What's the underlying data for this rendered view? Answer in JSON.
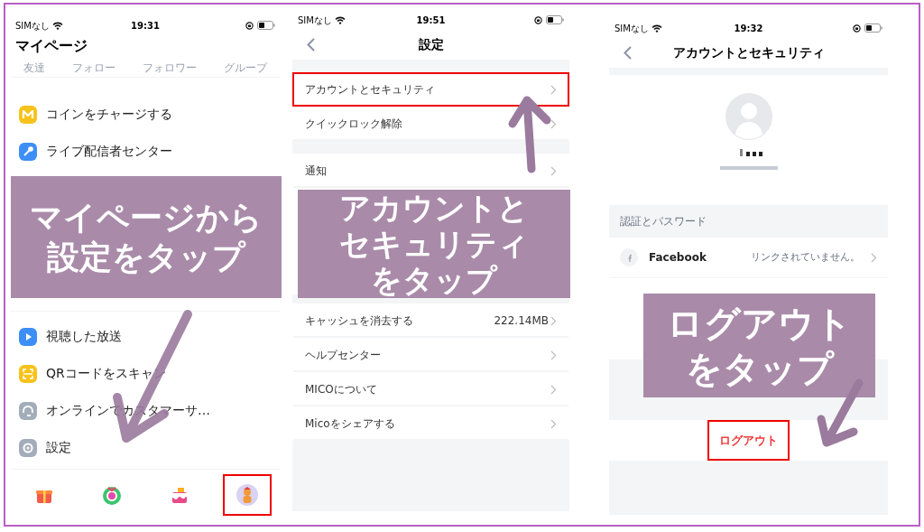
{
  "my_page": {
    "status": {
      "carrier": "SIMなし",
      "time": "19:31"
    },
    "title": "マイページ",
    "tabs": [
      "友達",
      "フォロー",
      "フォロワー",
      "グループ"
    ],
    "sections": [
      {
        "kind": "partly_covered",
        "items": [
          {
            "label": "コインをチャージする"
          },
          {
            "label": "ライブ配信者センター"
          }
        ]
      },
      {
        "kind": "plain",
        "items": [
          {
            "label": "視聴した放送"
          },
          {
            "label": "QRコードをスキャン"
          },
          {
            "label": "オンラインでカスタマーサ…"
          },
          {
            "label": "設定"
          }
        ]
      }
    ],
    "bottom_nav": [
      {
        "highlighted": false
      },
      {
        "highlighted": false
      },
      {
        "highlighted": false
      },
      {
        "highlighted": true
      }
    ]
  },
  "settings": {
    "status": {
      "carrier": "SIMなし",
      "time": "19:51"
    },
    "title": "設定",
    "groups": [
      {
        "kind": "plain",
        "rows": [
          {
            "label": "アカウントとセキュリティ",
            "highlighted": true
          },
          {
            "label": "クイックロック解除",
            "highlighted": false
          }
        ]
      },
      {
        "kind": "partly_covered",
        "rows": [
          {
            "label": "通知",
            "highlighted": false
          }
        ]
      },
      {
        "kind": "plain",
        "rows": [
          {
            "label": "キャッシュを消去する",
            "value": "222.14MB",
            "highlighted": false
          },
          {
            "label": "ヘルプセンター",
            "highlighted": false
          },
          {
            "label": "MICOについて",
            "highlighted": false
          },
          {
            "label": "Micoをシェアする",
            "highlighted": false
          }
        ]
      }
    ]
  },
  "account": {
    "status": {
      "carrier": "SIMなし",
      "time": "19:32"
    },
    "title": "アカウントとセキュリティ",
    "section_header": "認証とパスワード",
    "linked_accounts": [
      {
        "label": "Facebook",
        "value": "リンクされていません。"
      }
    ],
    "logout": {
      "label": "ログアウト",
      "highlighted": true
    }
  },
  "callouts": [
    {
      "lines": [
        "マイページから",
        "設定をタップ"
      ]
    },
    {
      "lines": [
        "アカウントと",
        "セキュリティ",
        "をタップ"
      ]
    },
    {
      "lines": [
        "ログアウト",
        "をタップ"
      ]
    }
  ]
}
